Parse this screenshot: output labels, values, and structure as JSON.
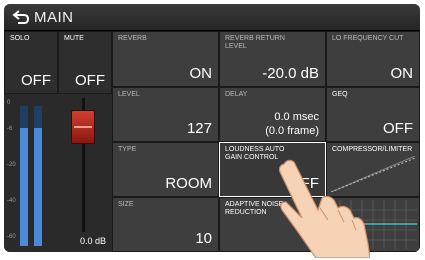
{
  "header": {
    "title": "MAIN"
  },
  "solo": {
    "label": "SOLO",
    "value": "OFF"
  },
  "mute": {
    "label": "MUTE",
    "value": "OFF"
  },
  "reverb": {
    "label": "REVERB",
    "value": "ON"
  },
  "reverb_return": {
    "label": "REVERB RETURN LEVEL",
    "value": "-20.0 dB"
  },
  "lo_freq_cut": {
    "label": "LO FREQUENCY CUT",
    "value": "ON"
  },
  "level": {
    "label": "LEVEL",
    "value": "127"
  },
  "delay": {
    "label": "DELAY",
    "value_msec": "0.0 msec",
    "value_frame": "(0.0 frame)"
  },
  "geq": {
    "label": "GEQ",
    "value": "OFF"
  },
  "type": {
    "label": "TYPE",
    "value": "ROOM"
  },
  "loudness": {
    "label": "LOUDNESS AUTO GAIN CONTROL",
    "value": "OFF"
  },
  "compressor": {
    "label": "COMPRESSOR/LIMITER"
  },
  "size": {
    "label": "SIZE",
    "value": "10"
  },
  "adaptive_nr": {
    "label": "ADAPTIVE NOISE REDUCTION"
  },
  "meter": {
    "scale": [
      "0",
      "-6",
      "-20",
      "-40",
      "-60"
    ],
    "fader_value": "0.0 dB"
  },
  "colors": {
    "meter": "#4a8ad8",
    "fader": "#c0392b",
    "selected_border": "#ffffff"
  }
}
